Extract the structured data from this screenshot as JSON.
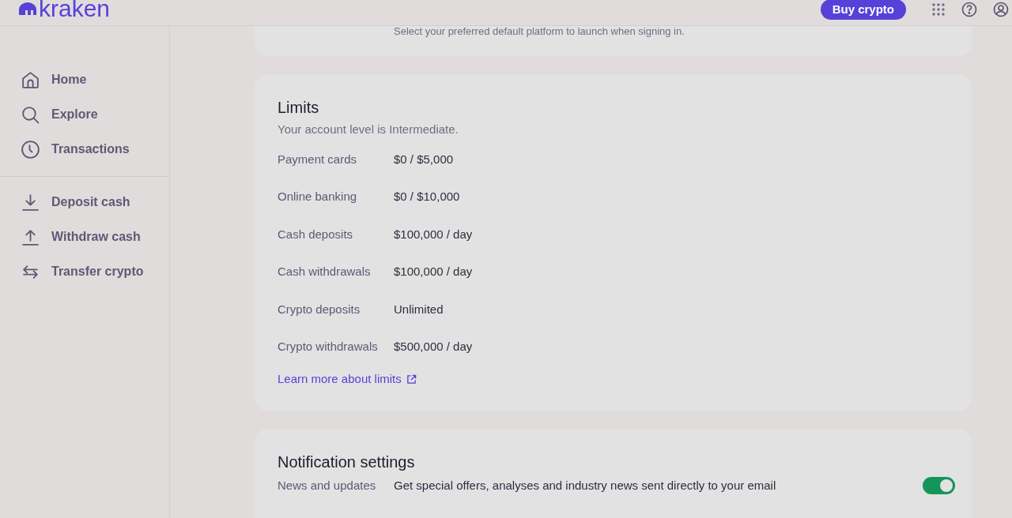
{
  "header": {
    "logo": "kraken",
    "buy_button": "Buy crypto"
  },
  "sidebar": {
    "primary": [
      {
        "kind": "home",
        "label": "Home"
      },
      {
        "kind": "explore",
        "label": "Explore"
      },
      {
        "kind": "transactions",
        "label": "Transactions"
      }
    ],
    "actions": [
      {
        "kind": "deposit",
        "label": "Deposit cash"
      },
      {
        "kind": "withdraw",
        "label": "Withdraw cash"
      },
      {
        "kind": "transfer",
        "label": "Transfer crypto"
      }
    ]
  },
  "platform_card": {
    "description": "Select your preferred default platform to launch when signing in."
  },
  "limits": {
    "title": "Limits",
    "subtitle": "Your account level is Intermediate.",
    "rows": [
      {
        "label": "Payment cards",
        "value": "$0 / $5,000"
      },
      {
        "label": "Online banking",
        "value": "$0 / $10,000"
      },
      {
        "label": "Cash deposits",
        "value": "$100,000 / day"
      },
      {
        "label": "Cash withdrawals",
        "value": "$100,000 / day"
      },
      {
        "label": "Crypto deposits",
        "value": "Unlimited"
      },
      {
        "label": "Crypto withdrawals",
        "value": "$500,000 / day"
      }
    ],
    "link": "Learn more about limits"
  },
  "notifications": {
    "title": "Notification settings",
    "items": [
      {
        "label": "News and updates",
        "description": "Get special offers, analyses and industry news sent directly to your email",
        "on": true
      }
    ]
  }
}
